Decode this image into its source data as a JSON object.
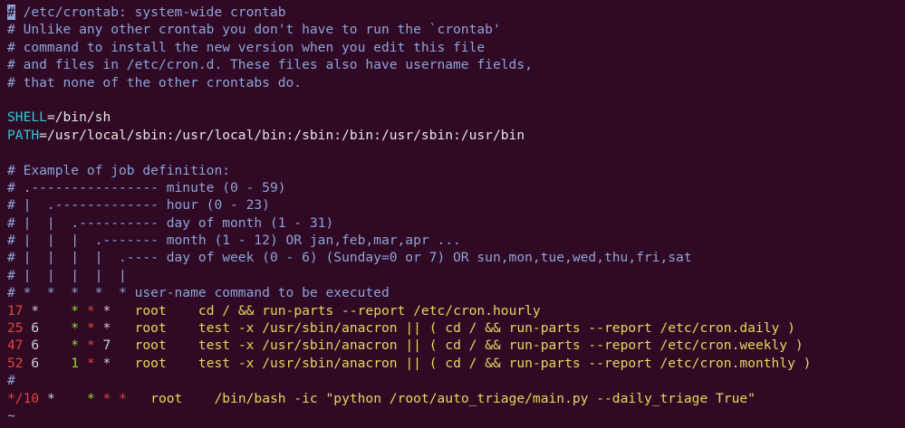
{
  "terminal": {
    "header_lines": [
      "/etc/crontab: system-wide crontab",
      "# Unlike any other crontab you don't have to run the `crontab'",
      "# command to install the new version when you edit this file",
      "# and files in /etc/cron.d. These files also have username fields,",
      "# that none of the other crontabs do."
    ],
    "cursor_char": "#",
    "shell_var": "SHELL",
    "shell_value": "=/bin/sh",
    "path_var": "PATH",
    "path_value": "=/usr/local/sbin:/usr/local/bin:/sbin:/bin:/usr/sbin:/usr/bin",
    "example_lines": [
      "# Example of job definition:",
      "# .---------------- minute (0 - 59)",
      "# |  .------------- hour (0 - 23)",
      "# |  |  .---------- day of month (1 - 31)",
      "# |  |  |  .------- month (1 - 12) OR jan,feb,mar,apr ...",
      "# |  |  |  |  .---- day of week (0 - 6) (Sunday=0 or 7) OR sun,mon,tue,wed,thu,fri,sat",
      "# |  |  |  |  |",
      "# *  *  *  *  * user-name command to be executed"
    ],
    "jobs": [
      {
        "min": "17",
        "hour": " *",
        "dom": "    *",
        "mon": " *",
        "dow": " *",
        "user": "   root",
        "cmd": "    cd / && run-parts --report /etc/cron.hourly"
      },
      {
        "min": "25",
        "hour": " 6",
        "dom": "    *",
        "mon": " *",
        "dow": " *",
        "user": "   root",
        "cmd": "    test -x /usr/sbin/anacron || ( cd / && run-parts --report /etc/cron.daily )"
      },
      {
        "min": "47",
        "hour": " 6",
        "dom": "    *",
        "mon": " *",
        "dow": " 7",
        "user": "   root",
        "cmd": "    test -x /usr/sbin/anacron || ( cd / && run-parts --report /etc/cron.weekly )"
      },
      {
        "min": "52",
        "hour": " 6",
        "dom": "    1",
        "mon": " *",
        "dow": " *",
        "user": "   root",
        "cmd": "    test -x /usr/sbin/anacron || ( cd / && run-parts --report /etc/cron.monthly )"
      }
    ],
    "hash_line": "#",
    "custom_job": {
      "min": "*/10",
      "hour": " *",
      "dom": "    *",
      "mon": " *",
      "dow": " *",
      "user": "   root",
      "cmd": "    /bin/bash -ic \"python /root/auto_triage/main.py --daily_triage True\""
    },
    "tilde": "~"
  }
}
